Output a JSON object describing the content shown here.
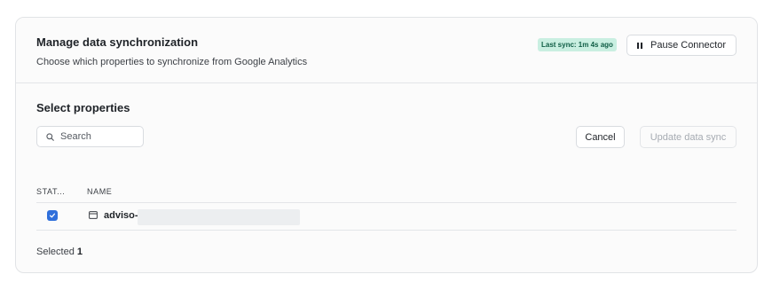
{
  "header": {
    "title": "Manage data synchronization",
    "subtitle": "Choose which properties to synchronize from Google Analytics",
    "sync_status": "Last sync: 1m 4s ago",
    "pause_label": "Pause Connector"
  },
  "properties": {
    "title": "Select properties",
    "search_placeholder": "Search",
    "search_value": "",
    "cancel_label": "Cancel",
    "update_label": "Update data sync",
    "columns": {
      "status": "STAT...",
      "name": "NAME"
    },
    "rows": [
      {
        "name": "adviso-",
        "checked": true
      }
    ],
    "selected_label": "Selected",
    "selected_count": "1"
  },
  "colors": {
    "accent": "#2f6fdb",
    "badge_bg": "#c9efe1",
    "badge_text": "#0f5d45"
  },
  "icons": {
    "pause": "pause-icon",
    "search": "search-icon",
    "checkbox": "check-icon",
    "row": "window-icon"
  }
}
